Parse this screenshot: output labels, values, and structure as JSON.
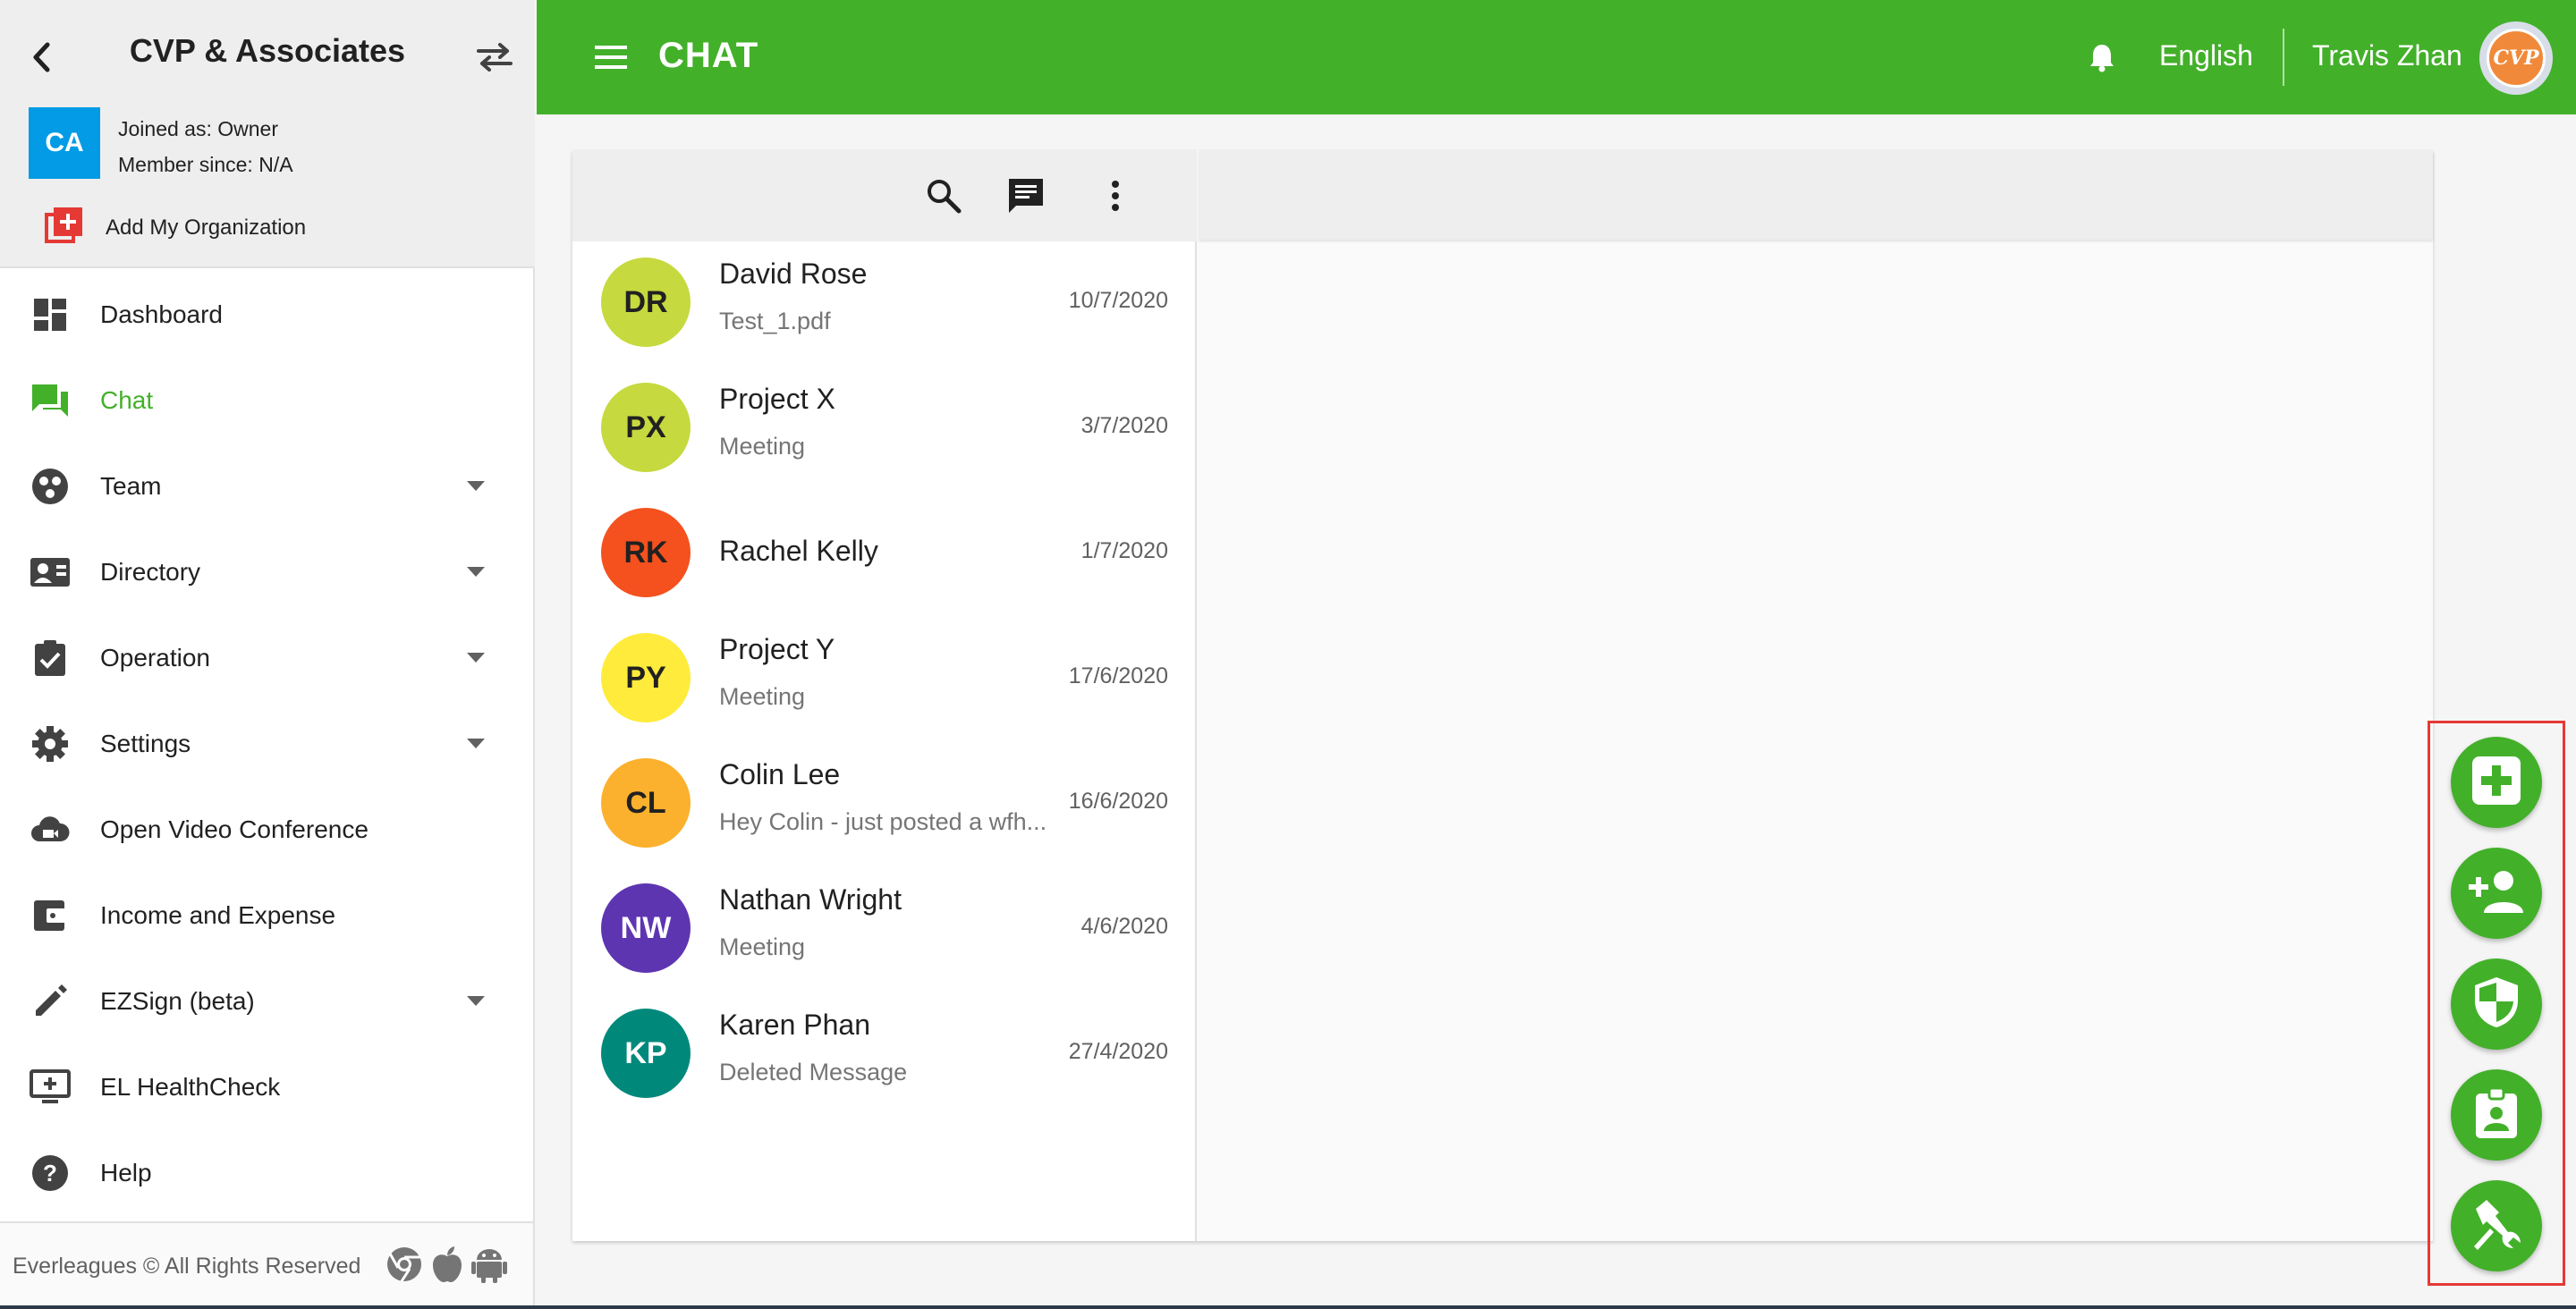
{
  "sidebar": {
    "org_name": "CVP & Associates",
    "avatar_initials": "CA",
    "joined_as": "Joined as: Owner",
    "member_since": "Member since: N/A",
    "add_org_label": "Add My Organization",
    "nav": [
      {
        "label": "Dashboard",
        "icon": "dashboard-icon"
      },
      {
        "label": "Chat",
        "icon": "chat-icon",
        "active": true
      },
      {
        "label": "Team",
        "icon": "team-icon",
        "expandable": true
      },
      {
        "label": "Directory",
        "icon": "contact-card-icon",
        "expandable": true
      },
      {
        "label": "Operation",
        "icon": "clipboard-check-icon",
        "expandable": true
      },
      {
        "label": "Settings",
        "icon": "gear-icon",
        "expandable": true
      },
      {
        "label": "Open Video Conference",
        "icon": "video-cloud-icon"
      },
      {
        "label": "Income and Expense",
        "icon": "wallet-icon"
      },
      {
        "label": "EZSign (beta)",
        "icon": "pencil-icon",
        "expandable": true
      },
      {
        "label": "EL HealthCheck",
        "icon": "monitor-plus-icon"
      },
      {
        "label": "Help",
        "icon": "help-icon"
      }
    ],
    "footer": {
      "copyright": "Everleagues © All Rights Reserved",
      "platform_icons": [
        "chrome-icon",
        "apple-icon",
        "android-icon"
      ]
    }
  },
  "topbar": {
    "title": "CHAT",
    "language": "English",
    "user_name": "Travis Zhan",
    "user_avatar_text": "CVP",
    "color": "#43b02a"
  },
  "conversations": [
    {
      "initials": "DR",
      "name": "David Rose",
      "preview": "Test_1.pdf",
      "date": "10/7/2020",
      "avatar_color": "#c6d93e",
      "text_color": "#212121"
    },
    {
      "initials": "PX",
      "name": "Project X",
      "preview": "Meeting",
      "date": "3/7/2020",
      "avatar_color": "#c6d93e",
      "text_color": "#212121"
    },
    {
      "initials": "RK",
      "name": "Rachel Kelly",
      "preview": "",
      "date": "1/7/2020",
      "avatar_color": "#f4511e",
      "text_color": "#212121"
    },
    {
      "initials": "PY",
      "name": "Project Y",
      "preview": "Meeting",
      "date": "17/6/2020",
      "avatar_color": "#ffeb3b",
      "text_color": "#212121"
    },
    {
      "initials": "CL",
      "name": "Colin Lee",
      "preview": "Hey Colin - just posted a wfh...",
      "date": "16/6/2020",
      "avatar_color": "#fbb12d",
      "text_color": "#212121"
    },
    {
      "initials": "NW",
      "name": "Nathan Wright",
      "preview": "Meeting",
      "date": "4/6/2020",
      "avatar_color": "#5e35b1",
      "text_color": "#ffffff"
    },
    {
      "initials": "KP",
      "name": "Karen Phan",
      "preview": "Deleted Message",
      "date": "27/4/2020",
      "avatar_color": "#00897b",
      "text_color": "#ffffff"
    }
  ],
  "list_toolbar_icons": [
    "search-icon",
    "new-message-icon",
    "more-vertical-icon"
  ],
  "fab_actions": [
    "medical-plus-icon",
    "add-person-icon",
    "shield-icon",
    "badge-icon",
    "tools-icon"
  ]
}
